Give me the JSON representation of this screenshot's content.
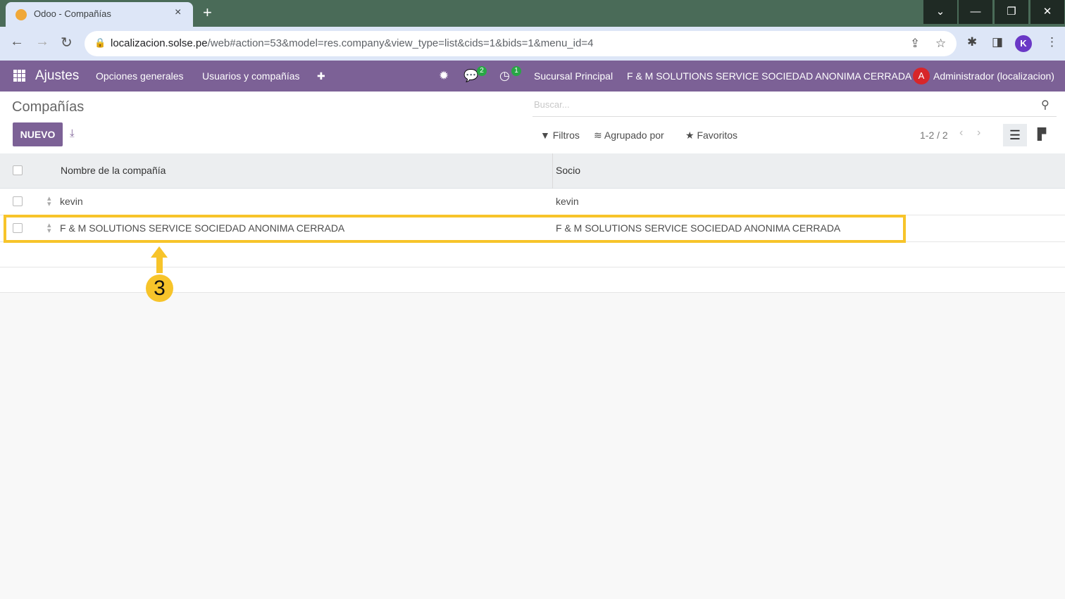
{
  "browser": {
    "tab_title": "Odoo - Compañías",
    "tab_close": "×",
    "new_tab": "+",
    "url_host": "localizacion.solse.pe",
    "url_rest": "/web#action=53&model=res.company&view_type=list&cids=1&bids=1&menu_id=4",
    "profile_initial": "K",
    "window_controls": [
      "⌄",
      "—",
      "❐",
      "✕"
    ]
  },
  "navbar": {
    "app_name": "Ajustes",
    "menu_items": [
      "Opciones generales",
      "Usuarios y compañías"
    ],
    "add_icon": "✚",
    "messages_badge": "2",
    "activities_badge": "1",
    "branch": "Sucursal Principal",
    "company": "F & M SOLUTIONS SERVICE SOCIEDAD ANONIMA CERRADA",
    "user_initial": "A",
    "user_name": "Administrador (localizacion)"
  },
  "control_panel": {
    "breadcrumb": "Compañías",
    "search_placeholder": "Buscar...",
    "new_button": "NUEVO",
    "filters": "Filtros",
    "group_by": "Agrupado por",
    "favorites": "Favoritos",
    "pager": "1-2 / 2"
  },
  "table": {
    "columns": [
      "Nombre de la compañía",
      "Socio"
    ],
    "rows": [
      {
        "name": "kevin",
        "partner": "kevin"
      },
      {
        "name": "F & M SOLUTIONS SERVICE SOCIEDAD ANONIMA CERRADA",
        "partner": "F & M SOLUTIONS SERVICE SOCIEDAD ANONIMA CERRADA"
      }
    ]
  },
  "annotation": {
    "step_number": "3",
    "color": "#f7c42a"
  },
  "colors": {
    "odoo_primary": "#7c6196",
    "browser_frame": "#4a6b58"
  }
}
